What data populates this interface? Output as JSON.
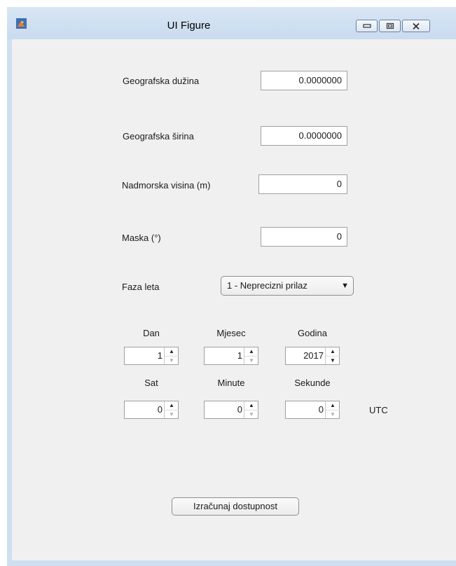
{
  "window": {
    "title": "UI Figure",
    "icon": "matlab-icon",
    "controls": [
      "minimize-icon",
      "maximize-icon",
      "close-icon"
    ]
  },
  "location": {
    "longitude": {
      "label": "Geografska dužina",
      "value": "0.0000000"
    },
    "latitude": {
      "label": "Geografska širina",
      "value": "0.0000000"
    },
    "altitude": {
      "label": "Nadmorska visina (m)",
      "value": "0"
    },
    "mask": {
      "label": "Maska (°)",
      "value": "0"
    }
  },
  "flight_phase": {
    "label": "Faza leta",
    "selected": "1 - Neprecizni prilaz"
  },
  "date": {
    "day": {
      "label": "Dan",
      "value": "1"
    },
    "month": {
      "label": "Mjesec",
      "value": "1"
    },
    "year": {
      "label": "Godina",
      "value": "2017"
    }
  },
  "time": {
    "hour": {
      "label": "Sat",
      "value": "0"
    },
    "minute": {
      "label": "Minute",
      "value": "0"
    },
    "second": {
      "label": "Sekunde",
      "value": "0"
    },
    "timezone": "UTC"
  },
  "actions": {
    "compute_label": "Izračunaj dostupnost"
  }
}
